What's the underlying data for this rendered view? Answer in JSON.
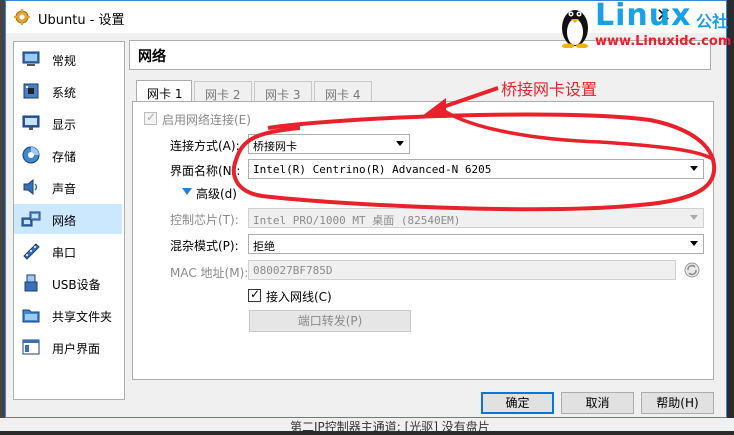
{
  "window": {
    "title": "Ubuntu - 设置",
    "close_glyph": "✕"
  },
  "watermark": {
    "brand": "Linux",
    "brand_cn": "公社",
    "url": "www.Linuxidc.com"
  },
  "sidebar": {
    "items": [
      {
        "label": "常规",
        "icon": "general-icon"
      },
      {
        "label": "系统",
        "icon": "system-icon"
      },
      {
        "label": "显示",
        "icon": "display-icon"
      },
      {
        "label": "存储",
        "icon": "storage-icon"
      },
      {
        "label": "声音",
        "icon": "audio-icon"
      },
      {
        "label": "网络",
        "icon": "network-icon",
        "selected": true
      },
      {
        "label": "串口",
        "icon": "serial-port-icon"
      },
      {
        "label": "USB设备",
        "icon": "usb-icon"
      },
      {
        "label": "共享文件夹",
        "icon": "shared-folder-icon"
      },
      {
        "label": "用户界面",
        "icon": "user-interface-icon"
      }
    ]
  },
  "header": {
    "title": "网络"
  },
  "tabs": [
    {
      "label": "网卡 1",
      "active": true
    },
    {
      "label": "网卡 2"
    },
    {
      "label": "网卡 3"
    },
    {
      "label": "网卡 4"
    }
  ],
  "form": {
    "enable_label": "启用网络连接(E)",
    "attach_label": "连接方式(A):",
    "attach_value": "桥接网卡",
    "name_label": "界面名称(N):",
    "name_value": "Intel(R) Centrino(R) Advanced-N 6205",
    "advanced_label": "高级(d)",
    "adapter_type_label": "控制芯片(T):",
    "adapter_type_value": "Intel PRO/1000 MT 桌面 (82540EM)",
    "promisc_label": "混杂模式(P):",
    "promisc_value": "拒绝",
    "mac_label": "MAC 地址(M):",
    "mac_value": "080027BF785D",
    "cable_label": "接入网线(C)",
    "port_forward_label": "端口转发(P)"
  },
  "buttons": {
    "ok": "确定",
    "cancel": "取消",
    "help": "帮助(H)"
  },
  "annotation": {
    "text": "桥接网卡设置",
    "color": "#e8212b"
  },
  "background": {
    "text": "第二IP控制器主通道: [光驱] 没有盘片"
  }
}
